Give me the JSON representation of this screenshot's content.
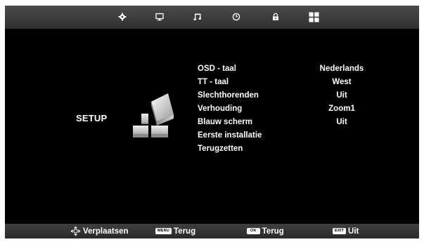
{
  "title": "SETUP",
  "menu": {
    "items": [
      {
        "label": "OSD - taal",
        "value": "Nederlands"
      },
      {
        "label": "TT - taal",
        "value": "West"
      },
      {
        "label": "Slechthorenden",
        "value": "Uit"
      },
      {
        "label": "Verhouding",
        "value": "Zoom1"
      },
      {
        "label": "Blauw scherm",
        "value": "Uit"
      },
      {
        "label": "Eerste installatie",
        "value": ""
      },
      {
        "label": "Terugzetten",
        "value": ""
      }
    ]
  },
  "top_icons": [
    "settings-gear-icon",
    "monitor-icon",
    "music-note-icon",
    "clock-icon",
    "lock-icon",
    "setup-grid-icon"
  ],
  "footer": {
    "move_label": "Verplaatsen",
    "menu_key": "MENU",
    "menu_label": "Terug",
    "ok_key": "OK",
    "ok_label": "Terug",
    "exit_key": "EXIT",
    "exit_label": "Uit"
  },
  "colors": {
    "background": "#000000",
    "text": "#ffffff",
    "bar": "#3a3a3a"
  }
}
